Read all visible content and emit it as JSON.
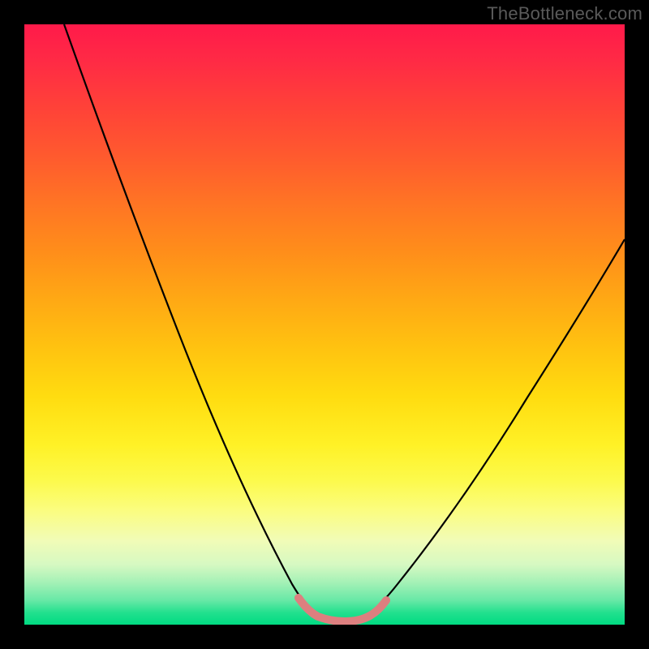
{
  "watermark": "TheBottleneck.com",
  "chart_data": {
    "type": "line",
    "title": "",
    "xlabel": "",
    "ylabel": "",
    "xlim": [
      0,
      100
    ],
    "ylim": [
      0,
      100
    ],
    "grid": false,
    "x": [
      0,
      5,
      10,
      15,
      20,
      25,
      30,
      35,
      40,
      45,
      47,
      50,
      55,
      58,
      60,
      65,
      70,
      75,
      80,
      85,
      90,
      95,
      100
    ],
    "series": [
      {
        "name": "bottleneck-curve",
        "color": "#000000",
        "values": [
          100,
          90,
          79,
          68,
          57,
          46,
          35,
          25,
          15,
          6,
          3,
          1,
          1,
          3,
          6,
          14,
          22,
          30,
          38,
          45,
          52,
          58,
          64
        ]
      }
    ],
    "highlight": {
      "name": "optimal-range",
      "color": "#e07878",
      "x_range": [
        46,
        59
      ],
      "values": [
        4.2,
        2.2,
        1.2,
        0.9,
        0.8,
        0.8,
        0.9,
        1.1,
        1.3,
        1.8,
        2.4,
        3.2,
        4.2,
        5.1
      ]
    },
    "background": {
      "type": "vertical-gradient",
      "stops": [
        {
          "pos": 0,
          "color": "#ff1a4a"
        },
        {
          "pos": 50,
          "color": "#ffc310"
        },
        {
          "pos": 80,
          "color": "#fbfd80"
        },
        {
          "pos": 100,
          "color": "#00db82"
        }
      ]
    }
  }
}
